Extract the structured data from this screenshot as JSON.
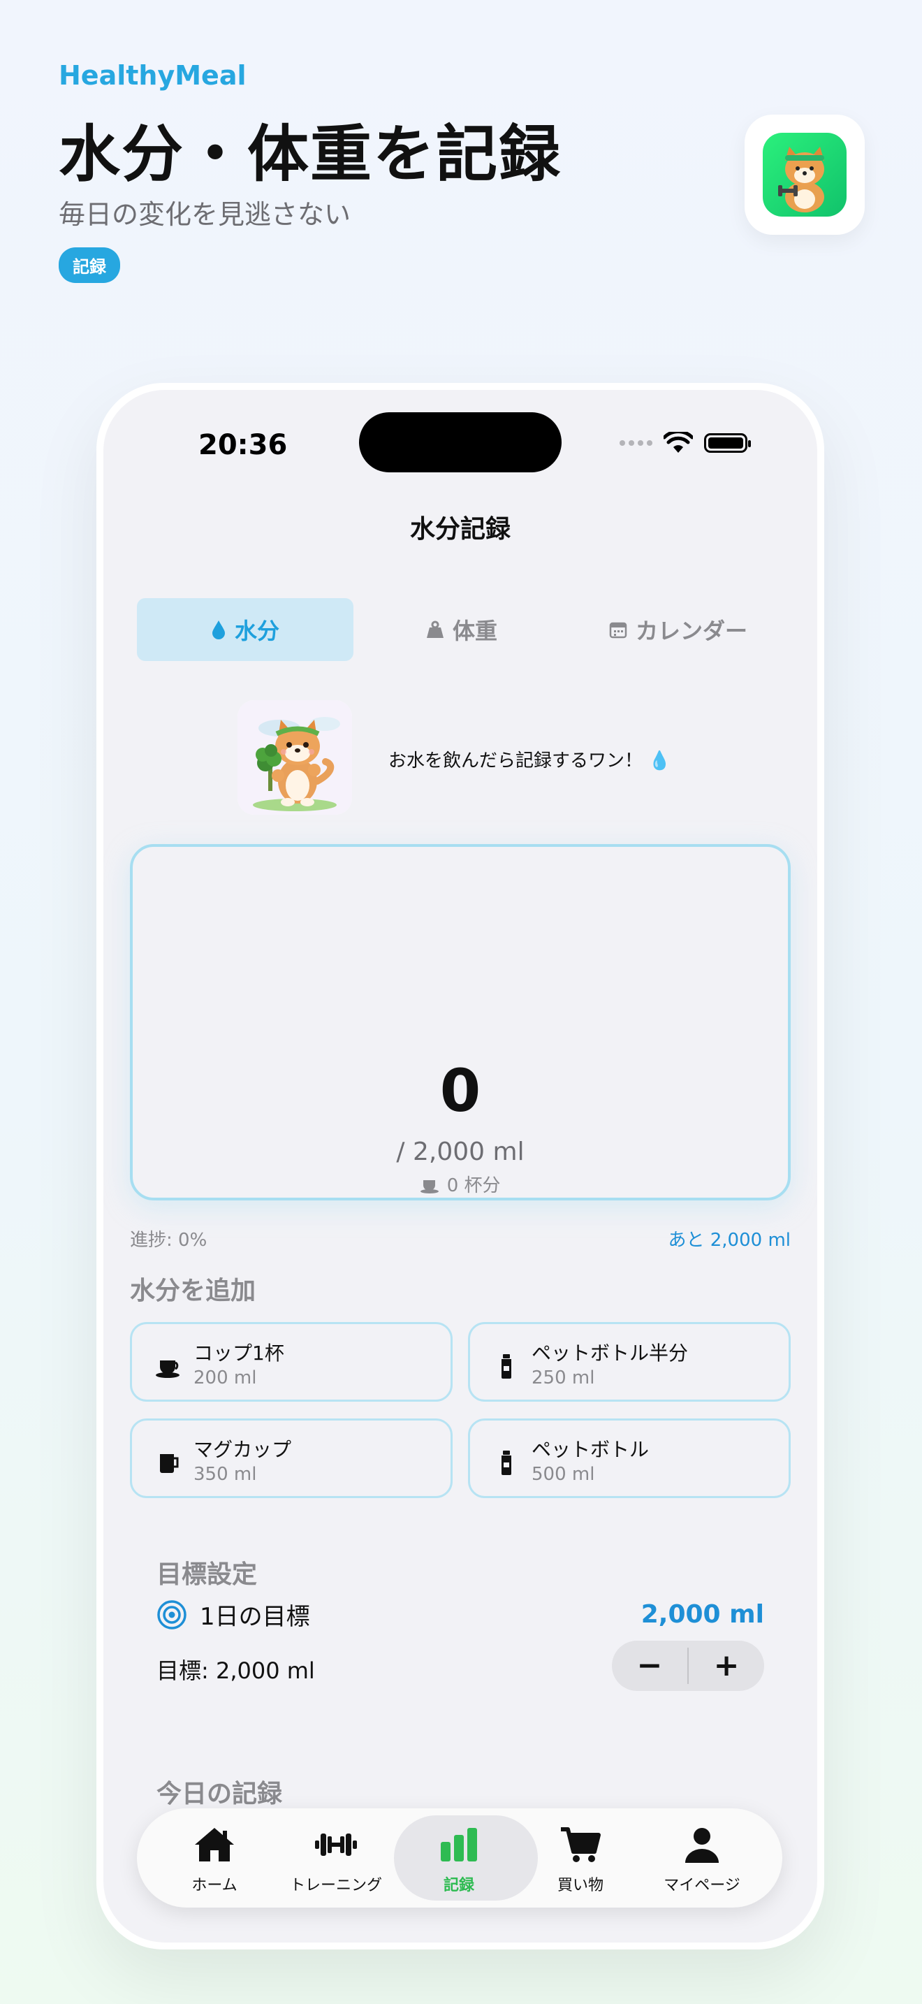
{
  "promo": {
    "brand": "HealthyMeal",
    "title": "水分・体重を記録",
    "subtitle": "毎日の変化を見逃さない",
    "badge": "記録"
  },
  "status_bar": {
    "time": "20:36"
  },
  "nav": {
    "title": "水分記録"
  },
  "segments": [
    {
      "icon": "water-drop-icon",
      "label": "水分",
      "active": true
    },
    {
      "icon": "scale-weight-icon",
      "label": "体重",
      "active": false
    },
    {
      "icon": "calendar-icon",
      "label": "カレンダー",
      "active": false
    }
  ],
  "mascot": {
    "message": "お水を飲んだら記録するワン！",
    "emoji": "💧"
  },
  "tracker": {
    "current": "0",
    "goal_text": "/ 2,000 ml",
    "cups_text": "0 杯分",
    "progress_fraction": 0
  },
  "progress": {
    "label": "進捗: 0%",
    "remaining": "あと 2,000 ml"
  },
  "add_water": {
    "title": "水分を追加",
    "options": [
      {
        "icon": "cup-saucer-icon",
        "name": "コップ1杯",
        "amount": "200 ml"
      },
      {
        "icon": "bottle-icon",
        "name": "ペットボトル半分",
        "amount": "250 ml"
      },
      {
        "icon": "mug-icon",
        "name": "マグカップ",
        "amount": "350 ml"
      },
      {
        "icon": "bottle-icon",
        "name": "ペットボトル",
        "amount": "500 ml"
      }
    ]
  },
  "goal": {
    "title": "目標設定",
    "daily_label": "1日の目標",
    "daily_value": "2,000 ml",
    "target_text": "目標: 2,000 ml",
    "minus": "−",
    "plus": "+"
  },
  "today": {
    "title": "今日の記録"
  },
  "tabbar": [
    {
      "icon": "home-icon",
      "label": "ホーム",
      "active": false
    },
    {
      "icon": "dumbbell-icon",
      "label": "トレーニング",
      "active": false
    },
    {
      "icon": "bar-chart-icon",
      "label": "記録",
      "active": true
    },
    {
      "icon": "cart-icon",
      "label": "買い物",
      "active": false
    },
    {
      "icon": "person-icon",
      "label": "マイページ",
      "active": false
    }
  ],
  "colors": {
    "accent": "#27a7e0",
    "active_tab": "#2ebb52",
    "tracker_border": "#a7def1"
  }
}
